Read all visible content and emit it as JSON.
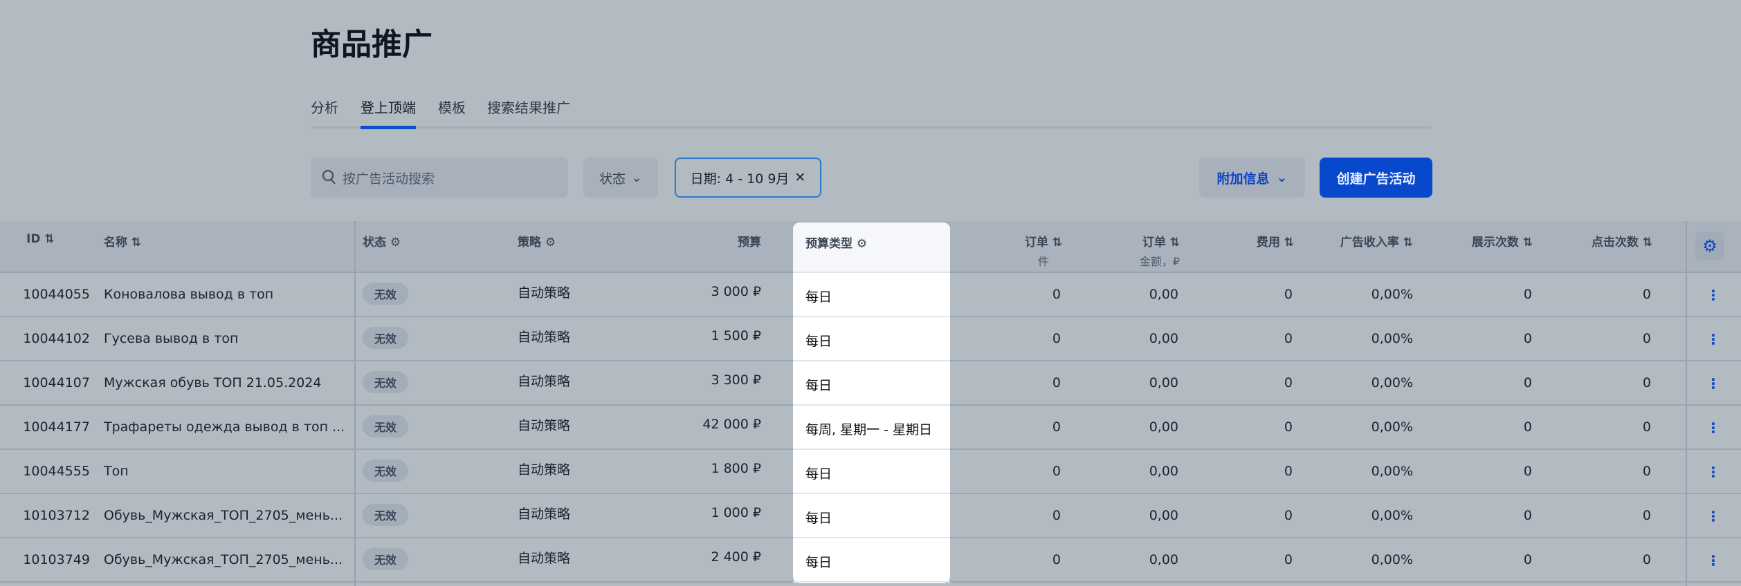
{
  "page": {
    "title": "商品推广"
  },
  "tabs": [
    {
      "label": "分析"
    },
    {
      "label": "登上顶端",
      "active": true
    },
    {
      "label": "模板"
    },
    {
      "label": "搜索结果推广"
    }
  ],
  "toolbar": {
    "search_placeholder": "按广告活动搜索",
    "status_label": "状态",
    "date_filter": "日期: 4 - 10 9月",
    "extra_info_label": "附加信息",
    "create_label": "创建广告活动"
  },
  "columns": {
    "id": "ID",
    "name": "名称",
    "status": "状态",
    "strategy": "策略",
    "budget": "预算",
    "budget_type": "预算类型",
    "orders": "订单",
    "orders_unit": "件",
    "orders_amount": "订单",
    "orders_amount_unit": "金额，₽",
    "cost": "费用",
    "drr": "广告收入率",
    "impressions": "展示次数",
    "clicks": "点击次数"
  },
  "accent_color": "#0848cc",
  "rows": [
    {
      "id": "10044055",
      "name": "Коновалова вывод в топ",
      "status": "无效",
      "strategy": "自动策略",
      "budget": "3 000 ₽",
      "budget_type": "每日",
      "orders": "0",
      "amount": "0,00",
      "cost": "0",
      "drr": "0,00%",
      "impressions": "0",
      "clicks": "0"
    },
    {
      "id": "10044102",
      "name": "Гусева вывод в топ",
      "status": "无效",
      "strategy": "自动策略",
      "budget": "1 500 ₽",
      "budget_type": "每日",
      "orders": "0",
      "amount": "0,00",
      "cost": "0",
      "drr": "0,00%",
      "impressions": "0",
      "clicks": "0"
    },
    {
      "id": "10044107",
      "name": "Мужская обувь ТОП 21.05.2024",
      "status": "无效",
      "strategy": "自动策略",
      "budget": "3 300 ₽",
      "budget_type": "每日",
      "orders": "0",
      "amount": "0,00",
      "cost": "0",
      "drr": "0,00%",
      "impressions": "0",
      "clicks": "0"
    },
    {
      "id": "10044177",
      "name": "Трафареты одежда вывод в топ ...",
      "status": "无效",
      "strategy": "自动策略",
      "budget": "42 000 ₽",
      "budget_type": "每周, 星期一 - 星期日",
      "orders": "0",
      "amount": "0,00",
      "cost": "0",
      "drr": "0,00%",
      "impressions": "0",
      "clicks": "0"
    },
    {
      "id": "10044555",
      "name": "Топ",
      "status": "无效",
      "strategy": "自动策略",
      "budget": "1 800 ₽",
      "budget_type": "每日",
      "orders": "0",
      "amount": "0,00",
      "cost": "0",
      "drr": "0,00%",
      "impressions": "0",
      "clicks": "0"
    },
    {
      "id": "10103712",
      "name": "Обувь_Мужская_ТОП_2705_мень...",
      "status": "无效",
      "strategy": "自动策略",
      "budget": "1 000 ₽",
      "budget_type": "每日",
      "orders": "0",
      "amount": "0,00",
      "cost": "0",
      "drr": "0,00%",
      "impressions": "0",
      "clicks": "0"
    },
    {
      "id": "10103749",
      "name": "Обувь_Мужская_ТОП_2705_мень...",
      "status": "无效",
      "strategy": "自动策略",
      "budget": "2 400 ₽",
      "budget_type": "每日",
      "orders": "0",
      "amount": "0,00",
      "cost": "0",
      "drr": "0,00%",
      "impressions": "0",
      "clicks": "0"
    }
  ]
}
